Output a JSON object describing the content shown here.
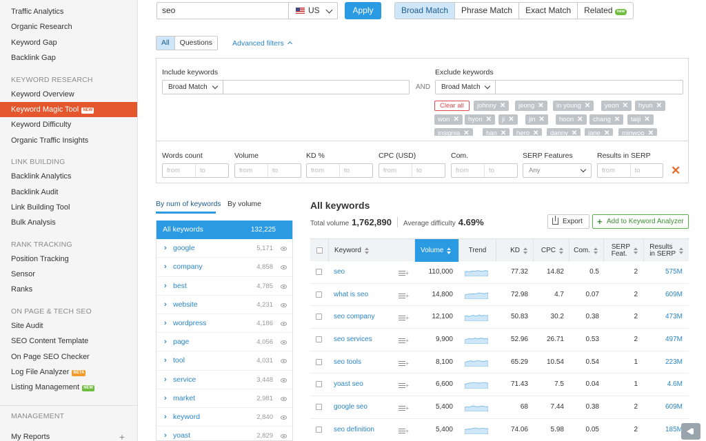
{
  "sidebar": {
    "items_top": [
      "Traffic Analytics",
      "Organic Research",
      "Keyword Gap",
      "Backlink Gap"
    ],
    "sections": [
      {
        "title": "KEYWORD RESEARCH",
        "items": [
          {
            "label": "Keyword Overview"
          },
          {
            "label": "Keyword Magic Tool",
            "badge": "new",
            "active": true
          },
          {
            "label": "Keyword Difficulty"
          },
          {
            "label": "Organic Traffic Insights"
          }
        ]
      },
      {
        "title": "LINK BUILDING",
        "items": [
          {
            "label": "Backlink Analytics"
          },
          {
            "label": "Backlink Audit"
          },
          {
            "label": "Link Building Tool"
          },
          {
            "label": "Bulk Analysis"
          }
        ]
      },
      {
        "title": "RANK TRACKING",
        "items": [
          {
            "label": "Position Tracking"
          },
          {
            "label": "Sensor"
          },
          {
            "label": "Ranks"
          }
        ]
      },
      {
        "title": "ON PAGE & TECH SEO",
        "items": [
          {
            "label": "Site Audit"
          },
          {
            "label": "SEO Content Template"
          },
          {
            "label": "On Page SEO Checker"
          },
          {
            "label": "Log File Analyzer",
            "badge": "beta"
          },
          {
            "label": "Listing Management",
            "badge": "new"
          }
        ]
      }
    ],
    "management_title": "MANAGEMENT",
    "my_reports": "My Reports",
    "plus": "+"
  },
  "search": {
    "value": "seo",
    "database": "US",
    "apply": "Apply"
  },
  "match_types": [
    {
      "label": "Broad Match",
      "selected": true
    },
    {
      "label": "Phrase Match"
    },
    {
      "label": "Exact Match"
    },
    {
      "label": "Related",
      "badge": "new"
    }
  ],
  "question_tabs": [
    {
      "label": "All",
      "selected": true
    },
    {
      "label": "Questions"
    }
  ],
  "advanced_filters": "Advanced filters",
  "filters": {
    "include_label": "Include keywords",
    "include_match": "Broad Match",
    "and_label": "AND",
    "exclude_label": "Exclude keywords",
    "exclude_match": "Broad Match",
    "clear_all": "Clear all",
    "excluded_words": [
      "johnny",
      "jeong",
      "in young",
      "yeon",
      "hyun",
      "won",
      "hyon",
      "ji",
      "jin",
      "hoon",
      "chang",
      "taiji",
      "insignia",
      "han",
      "hero",
      "danny",
      "jane",
      "minwoo",
      "guk"
    ],
    "ranges": [
      {
        "label": "Words count"
      },
      {
        "label": "Volume"
      },
      {
        "label": "KD %"
      },
      {
        "label": "CPC (USD)"
      },
      {
        "label": "Com."
      },
      {
        "label": "SERP Features",
        "select": "Any"
      },
      {
        "label": "Results in SERP"
      }
    ],
    "from_placeholder": "from",
    "to_placeholder": "to",
    "clear_x": "✕"
  },
  "group_tabs": [
    "By num of keywords",
    "By volume"
  ],
  "groups": {
    "all_label": "All keywords",
    "all_count": "132,225",
    "items": [
      {
        "name": "google",
        "count": "5,171"
      },
      {
        "name": "company",
        "count": "4,858"
      },
      {
        "name": "best",
        "count": "4,785"
      },
      {
        "name": "website",
        "count": "4,231"
      },
      {
        "name": "wordpress",
        "count": "4,186"
      },
      {
        "name": "page",
        "count": "4,056"
      },
      {
        "name": "tool",
        "count": "4,031"
      },
      {
        "name": "service",
        "count": "3,448"
      },
      {
        "name": "market",
        "count": "2,981"
      },
      {
        "name": "keyword",
        "count": "2,840"
      },
      {
        "name": "yoast",
        "count": "2,829"
      }
    ]
  },
  "results": {
    "title": "All keywords",
    "total_volume_label": "Total volume",
    "total_volume": "1,762,890",
    "avg_difficulty_label": "Average difficulty",
    "avg_difficulty": "4.69%",
    "export": "Export",
    "add_to_analyzer": "Add to Keyword Analyzer",
    "columns": {
      "keyword": "Keyword",
      "volume": "Volume",
      "trend": "Trend",
      "kd": "KD",
      "cpc": "CPC",
      "com": "Com.",
      "serp_1": "SERP",
      "serp_2": "Feat.",
      "results_1": "Results",
      "results_2": "in SERP"
    },
    "rows": [
      {
        "keyword": "seo",
        "volume": "110,000",
        "kd": "77.32",
        "cpc": "14.82",
        "com": "0.5",
        "serp": "2",
        "results": "575M",
        "trend": [
          0.55,
          0.6,
          0.55,
          0.6,
          0.65,
          0.6,
          0.7,
          0.65,
          0.6,
          0.65,
          0.7,
          0.6
        ]
      },
      {
        "keyword": "what is seo",
        "volume": "14,800",
        "kd": "72.98",
        "cpc": "4.7",
        "com": "0.07",
        "serp": "2",
        "results": "609M",
        "trend": [
          0.5,
          0.55,
          0.6,
          0.6,
          0.65,
          0.6,
          0.7,
          0.75,
          0.7,
          0.65,
          0.7,
          0.75
        ]
      },
      {
        "keyword": "seo company",
        "volume": "12,100",
        "kd": "50.83",
        "cpc": "30.2",
        "com": "0.38",
        "serp": "2",
        "results": "473M",
        "trend": [
          0.6,
          0.65,
          0.55,
          0.65,
          0.7,
          0.6,
          0.65,
          0.75,
          0.6,
          0.7,
          0.65,
          0.7
        ]
      },
      {
        "keyword": "seo services",
        "volume": "9,900",
        "kd": "52.96",
        "cpc": "26.71",
        "com": "0.53",
        "serp": "2",
        "results": "497M",
        "trend": [
          0.5,
          0.55,
          0.65,
          0.6,
          0.6,
          0.7,
          0.6,
          0.65,
          0.7,
          0.6,
          0.65,
          0.6
        ]
      },
      {
        "keyword": "seo tools",
        "volume": "8,100",
        "kd": "65.29",
        "cpc": "10.54",
        "com": "0.54",
        "serp": "1",
        "results": "223M",
        "trend": [
          0.5,
          0.6,
          0.65,
          0.7,
          0.6,
          0.65,
          0.75,
          0.7,
          0.65,
          0.6,
          0.7,
          0.65
        ]
      },
      {
        "keyword": "yoast seo",
        "volume": "6,600",
        "kd": "71.43",
        "cpc": "7.5",
        "com": "0.04",
        "serp": "1",
        "results": "4.6M",
        "trend": [
          0.55,
          0.6,
          0.65,
          0.7,
          0.75,
          0.7,
          0.7,
          0.65,
          0.7,
          0.75,
          0.7,
          0.65
        ]
      },
      {
        "keyword": "google seo",
        "volume": "5,400",
        "kd": "68",
        "cpc": "7.44",
        "com": "0.38",
        "serp": "2",
        "results": "609M",
        "trend": [
          0.5,
          0.55,
          0.5,
          0.6,
          0.65,
          0.6,
          0.55,
          0.6,
          0.65,
          0.6,
          0.55,
          0.6
        ]
      },
      {
        "keyword": "seo definition",
        "volume": "5,400",
        "kd": "74.06",
        "cpc": "5.98",
        "com": "0.05",
        "serp": "2",
        "results": "185M",
        "trend": [
          0.55,
          0.6,
          0.6,
          0.65,
          0.7,
          0.75,
          0.7,
          0.65,
          0.7,
          0.7,
          0.65,
          0.7
        ]
      }
    ]
  },
  "colors": {
    "accent": "#2a9ae2",
    "active_nav": "#e4572e",
    "new_badge": "#6fbd3e",
    "link": "#2a85c9"
  }
}
